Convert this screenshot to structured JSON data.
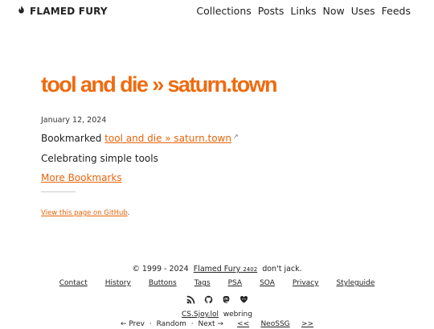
{
  "header": {
    "brand": "FLAMED FURY",
    "nav": [
      "Collections",
      "Posts",
      "Links",
      "Now",
      "Uses",
      "Feeds"
    ]
  },
  "post": {
    "title": "tool and die » saturn.town",
    "date": "January 12, 2024",
    "bookmarked_prefix": "Bookmarked",
    "bookmark_link": "tool and die » saturn.town",
    "external_icon": "↗",
    "description": "Celebrating simple tools",
    "more_link": "More Bookmarks",
    "github_link": "View this page on GitHub",
    "github_suffix": "."
  },
  "footer": {
    "copyright_prefix": "© 1999 - 2024",
    "site_name": "Flamed Fury",
    "site_sup": "2402",
    "tagline": "don't jack.",
    "links": [
      "Contact",
      "History",
      "Buttons",
      "Tags",
      "PSA",
      "SOA",
      "Privacy",
      "Styleguide"
    ],
    "icons": [
      "rss-icon",
      "github-icon",
      "mastodon-icon",
      "heart-bird-icon"
    ],
    "webring": {
      "site": "CS.Sjoy.lol",
      "label": "webring",
      "prev": "← Prev",
      "random": "Random",
      "next": "Next →",
      "left": "<<",
      "neossg": "NeoSSG",
      "right": ">>",
      "dot": "·"
    }
  },
  "colors": {
    "accent": "#ef6b10",
    "link": "#e8650a",
    "text": "#222222"
  }
}
